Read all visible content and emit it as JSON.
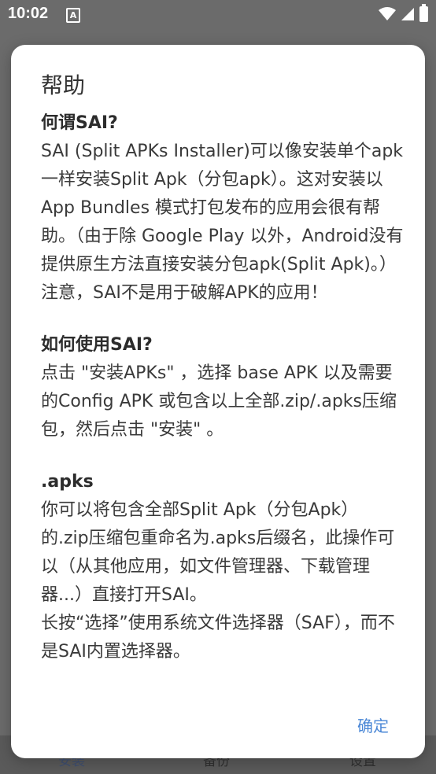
{
  "status_bar": {
    "time": "10:02",
    "notif_glyph": "A"
  },
  "bottom_nav": {
    "items": [
      "安装",
      "备份",
      "设置"
    ]
  },
  "dialog": {
    "title": "帮助",
    "sections": [
      {
        "title": "何谓SAI?",
        "paragraphs": [
          "SAI (Split APKs Installer)可以像安装单个apk一样安装Split Apk（分包apk）。这对安装以 App Bundles 模式打包发布的应用会很有帮助。（由于除 Google Play 以外，Android没有提供原生方法直接安装分包apk(Split Apk)。）",
          "注意，SAI不是用于破解APK的应用！"
        ]
      },
      {
        "title": "如何使用SAI?",
        "paragraphs": [
          "点击 \"安装APKs\" ，选择 base APK 以及需要的Config APK 或包含以上全部.zip/.apks压缩包，然后点击 \"安装\" 。"
        ]
      },
      {
        "title": ".apks",
        "paragraphs": [
          "你可以将包含全部Split Apk（分包Apk）的.zip压缩包重命名为.apks后缀名，此操作可以（从其他应用，如文件管理器、下载管理器...）直接打开SAI。",
          "长按“选择”使用系统文件选择器（SAF），而不是SAI内置选择器。"
        ]
      }
    ],
    "ok_label": "确定"
  }
}
